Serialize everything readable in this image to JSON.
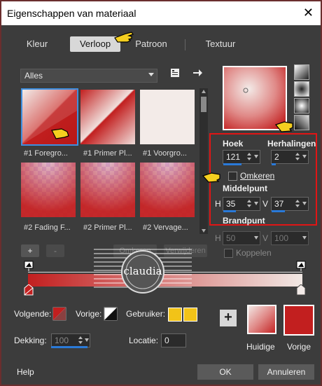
{
  "window": {
    "title": "Eigenschappen van materiaal",
    "close_glyph": "✕"
  },
  "tabs": [
    {
      "label": "Kleur"
    },
    {
      "label": "Verloop"
    },
    {
      "label": "Patroon"
    },
    {
      "label": "Textuur"
    }
  ],
  "library": {
    "dropdown_value": "Alles"
  },
  "thumbnails": [
    {
      "label": "#1 Foregro..."
    },
    {
      "label": "#1 Primer Pl..."
    },
    {
      "label": "#1 Voorgro..."
    },
    {
      "label": "#2 Fading F..."
    },
    {
      "label": "#2 Primer Pl..."
    },
    {
      "label": "#2 Vervage..."
    }
  ],
  "settings": {
    "hoek_label": "Hoek",
    "hoek_value": "121",
    "herhalingen_label": "Herhalingen",
    "herhalingen_value": "2",
    "omkeren_label": "Omkeren",
    "middelpunt_label": "Middelpunt",
    "h_label": "H",
    "h_value": "35",
    "v_label": "V",
    "v_value": "37",
    "brandpunt_label": "Brandpunt",
    "bh_label": "H",
    "bh_value": "50",
    "bv_label": "V",
    "bv_value": "100",
    "koppelen_label": "Koppelen"
  },
  "editor": {
    "plus": "+",
    "minus": "-",
    "reverse": "Omkeren",
    "remove": "Verwijderen"
  },
  "watermark": {
    "text": "claudia"
  },
  "bottom": {
    "volgende_label": "Volgende:",
    "vorige_label": "Vorige:",
    "gebruiker_label": "Gebruiker:",
    "dekking_label": "Dekking:",
    "dekking_value": "100",
    "locatie_label": "Locatie:",
    "locatie_value": "0",
    "huidige_label": "Huidige",
    "vorige_swatch_label": "Vorige",
    "plus": "+"
  },
  "footer": {
    "help": "Help",
    "ok": "OK",
    "cancel": "Annuleren"
  },
  "colors": {
    "accent": "#2a7ad8",
    "red": "#c21f1f",
    "highlight_box": "#e01515",
    "user_color": "#f2c318"
  }
}
